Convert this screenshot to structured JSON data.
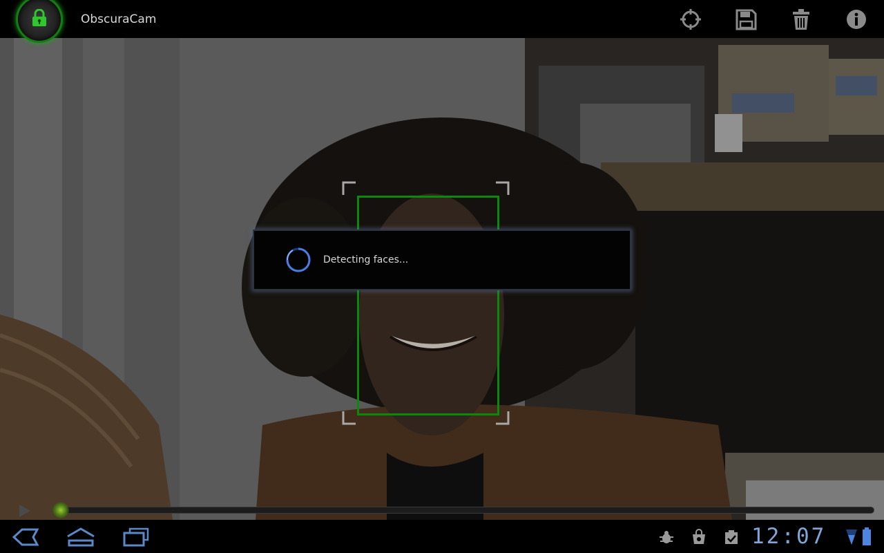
{
  "app": {
    "title": "ObscuraCam",
    "logo_icon": "lock-icon",
    "accent_color": "#1ea81e"
  },
  "action_bar": {
    "icons": [
      "crosshair-icon",
      "save-icon",
      "trash-icon",
      "info-icon"
    ]
  },
  "dialog": {
    "message": "Detecting faces...",
    "spinner_icon": "spinner-icon",
    "spinner_color": "#3c6fd1"
  },
  "media": {
    "play_icon": "play-icon",
    "progress": 0.0
  },
  "system_bar": {
    "nav_icons": [
      "back-icon",
      "home-icon",
      "recent-apps-icon"
    ],
    "status_icons": [
      "debug-icon",
      "shopping-bag-icon",
      "task-icon",
      "wifi-icon",
      "battery-icon"
    ],
    "clock": "12:07",
    "clock_color": "#7fa6d6"
  }
}
